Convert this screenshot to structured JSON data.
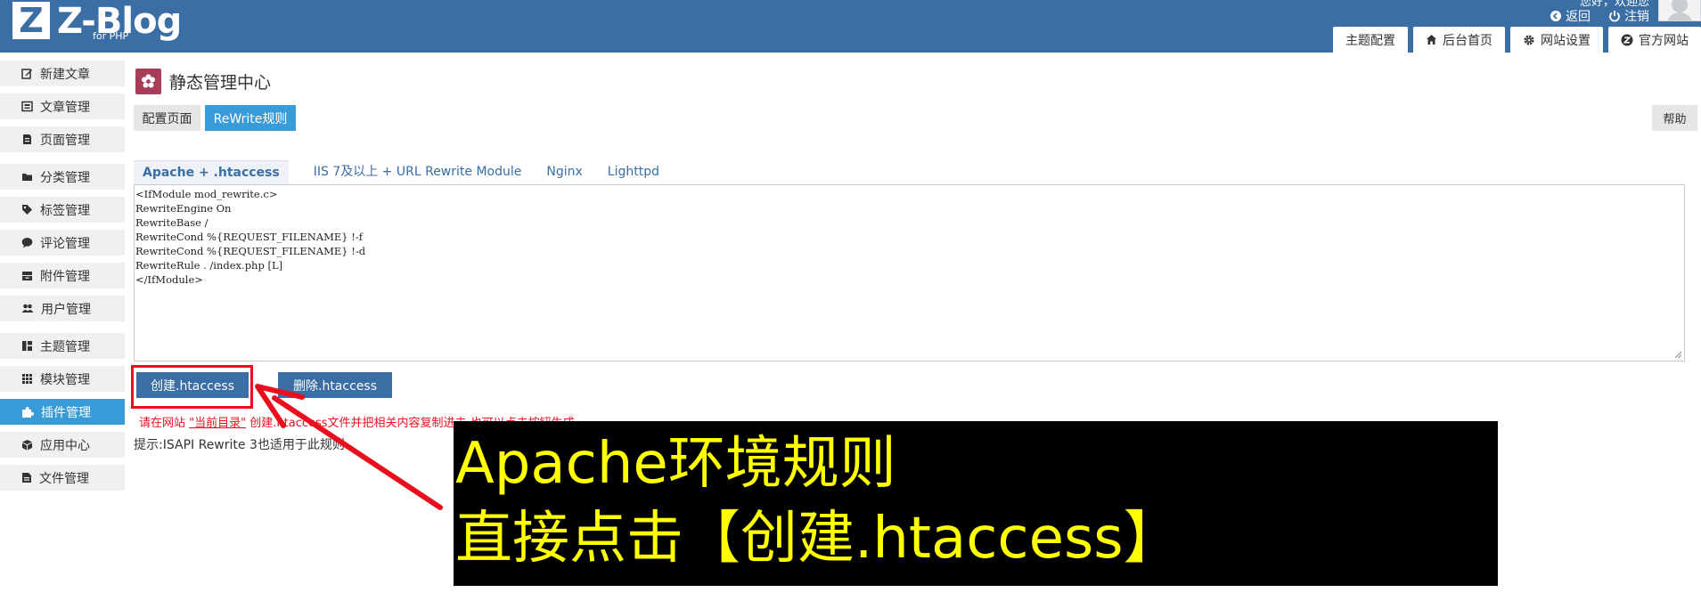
{
  "header": {
    "logo_mark": "Z",
    "logo_name": "Z-Blog",
    "logo_sub": "for PHP",
    "user_info": "您好，欢迎您",
    "links": [
      {
        "label": "返回",
        "icon": "back-circle-icon"
      },
      {
        "label": "注销",
        "icon": "power-icon"
      }
    ],
    "tabs": [
      {
        "label": "主题配置",
        "icon": ""
      },
      {
        "label": "后台首页",
        "icon": "home-icon"
      },
      {
        "label": "网站设置",
        "icon": "gear-icon"
      },
      {
        "label": "官方网站",
        "icon": "zblog-logo-icon"
      }
    ]
  },
  "sidebar": {
    "items": [
      {
        "label": "新建文章",
        "icon": "edit-icon"
      },
      {
        "label": "文章管理",
        "icon": "article-icon"
      },
      {
        "label": "页面管理",
        "icon": "page-icon"
      },
      {
        "label": "分类管理",
        "icon": "folder-icon"
      },
      {
        "label": "标签管理",
        "icon": "tag-icon"
      },
      {
        "label": "评论管理",
        "icon": "comment-icon"
      },
      {
        "label": "附件管理",
        "icon": "attachment-icon"
      },
      {
        "label": "用户管理",
        "icon": "users-icon"
      },
      {
        "label": "主题管理",
        "icon": "theme-icon"
      },
      {
        "label": "模块管理",
        "icon": "grid-icon"
      },
      {
        "label": "插件管理",
        "icon": "puzzle-icon",
        "active": true
      },
      {
        "label": "应用中心",
        "icon": "box-icon"
      },
      {
        "label": "文件管理",
        "icon": "file-icon"
      }
    ]
  },
  "main": {
    "title": "静态管理中心",
    "subtabs": [
      {
        "label": "配置页面"
      },
      {
        "label": "ReWrite规则",
        "active": true
      }
    ],
    "help_label": "帮助",
    "server_tabs": [
      {
        "label": "Apache + .htaccess",
        "active": true
      },
      {
        "label": "IIS 7及以上 + URL Rewrite Module"
      },
      {
        "label": "Nginx"
      },
      {
        "label": "Lighttpd"
      }
    ],
    "code_lines": [
      "<IfModule mod_rewrite.c>",
      "RewriteEngine On",
      "RewriteBase /",
      "RewriteCond %{REQUEST_FILENAME} !-f",
      "RewriteCond %{REQUEST_FILENAME} !-d",
      "RewriteRule . /index.php [L]",
      "</IfModule>"
    ],
    "create_button": "创建.htaccess",
    "delete_button": "删除.htaccess",
    "hint_red_prefix": "请在网站",
    "hint_red_link": "\"当前目录\"",
    "hint_red_suffix": "创建.htaccess文件并把相关内容复制进去,也可以点击按钮生成。",
    "hint_dark": "提示:ISAPI Rewrite 3也适用于此规则."
  },
  "overlay": {
    "line1": "Apache环境规则",
    "line2": "直接点击【创建.htaccess】",
    "highlight_color": "#e8101e",
    "caption_color": "#ffff00"
  }
}
